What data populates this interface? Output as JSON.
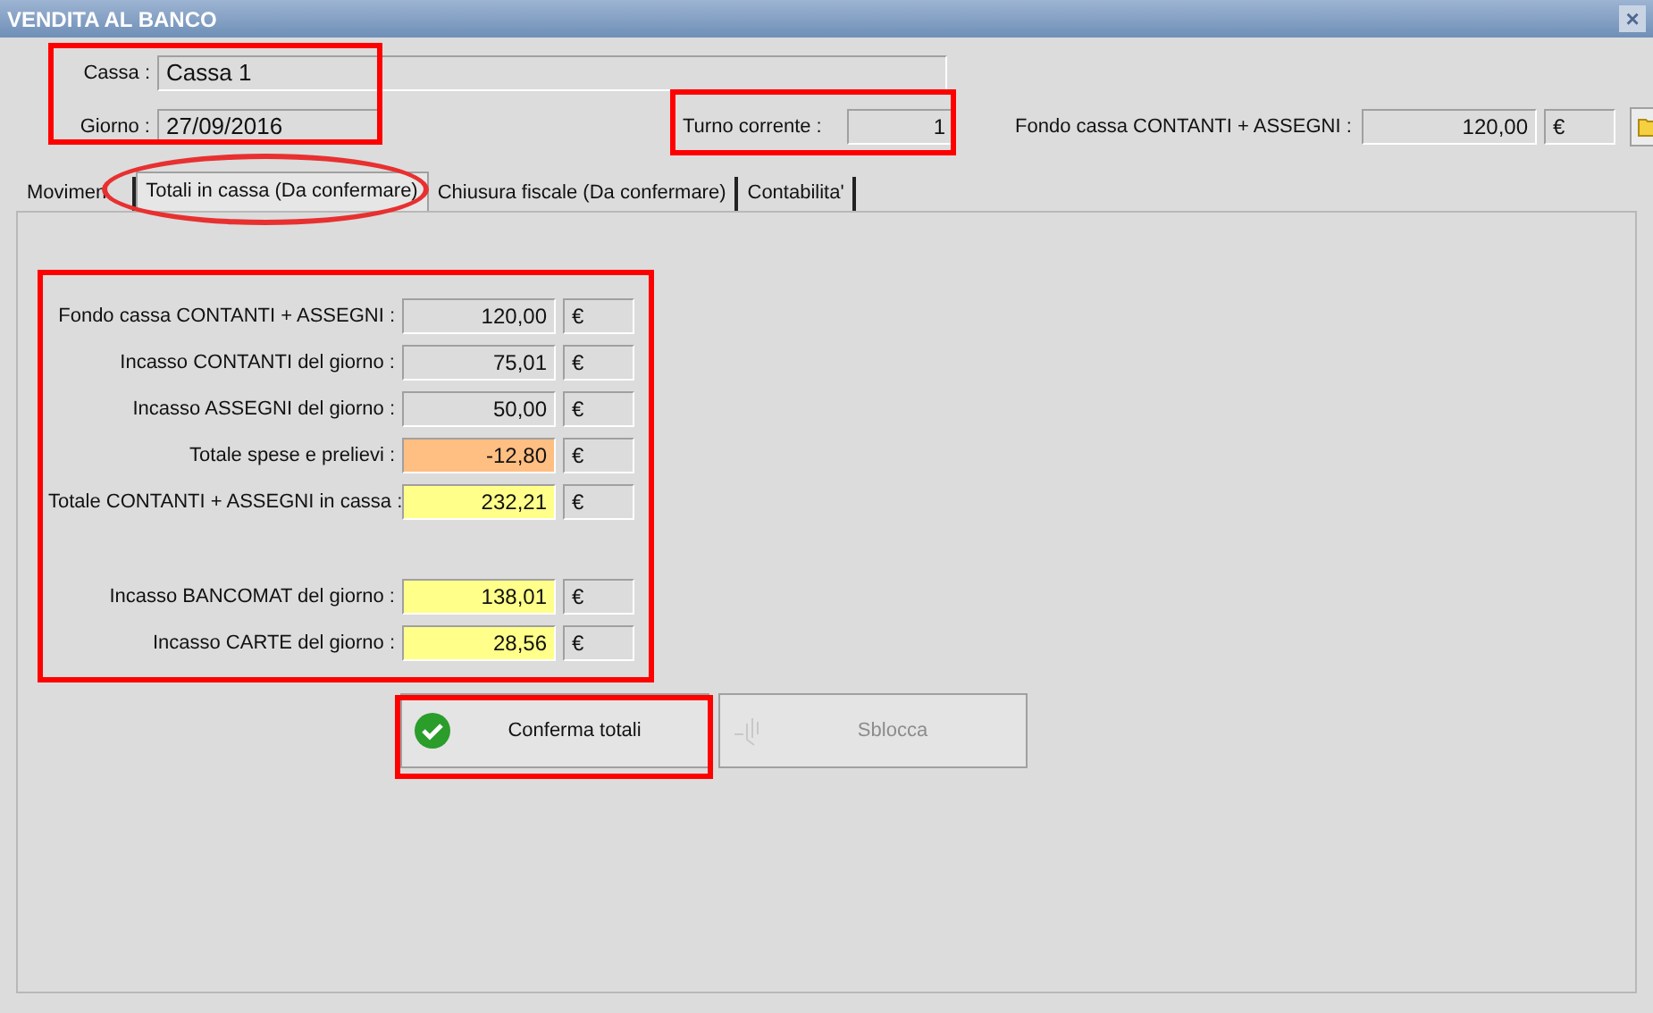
{
  "window": {
    "title": "VENDITA AL BANCO",
    "close": "×"
  },
  "header": {
    "cassa_label": "Cassa :",
    "cassa_value": "Cassa 1",
    "giorno_label": "Giorno :",
    "giorno_value": "27/09/2016",
    "turno_label": "Turno corrente :",
    "turno_value": "1",
    "fondo_label": "Fondo cassa CONTANTI + ASSEGNI :",
    "fondo_value": "120,00",
    "fondo_currency": "€"
  },
  "tabs": [
    {
      "label": "Movimen",
      "selected": false
    },
    {
      "label": "Totali in cassa (Da confermare)",
      "selected": true
    },
    {
      "label": "Chiusura fiscale (Da confermare)",
      "selected": false
    },
    {
      "label": "Contabilita'",
      "selected": false
    }
  ],
  "totals": [
    {
      "label": "Fondo cassa CONTANTI + ASSEGNI :",
      "value": "120,00",
      "currency": "€",
      "color": "#dcdcdc"
    },
    {
      "label": "Incasso CONTANTI del giorno :",
      "value": "75,01",
      "currency": "€",
      "color": "#dcdcdc"
    },
    {
      "label": "Incasso ASSEGNI del giorno :",
      "value": "50,00",
      "currency": "€",
      "color": "#dcdcdc"
    },
    {
      "label": "Totale spese e prelievi :",
      "value": "-12,80",
      "currency": "€",
      "color": "#ffbe82"
    },
    {
      "label": "Totale CONTANTI + ASSEGNI in cassa :",
      "value": "232,21",
      "currency": "€",
      "color": "#ffff8a"
    }
  ],
  "card_totals": [
    {
      "label": "Incasso BANCOMAT del giorno :",
      "value": "138,01",
      "currency": "€",
      "color": "#ffff8a"
    },
    {
      "label": "Incasso CARTE del giorno :",
      "value": "28,56",
      "currency": "€",
      "color": "#ffff8a"
    }
  ],
  "buttons": [
    {
      "label": "Conferma totali",
      "disabled": false
    },
    {
      "label": "Sblocca",
      "disabled": true
    }
  ]
}
